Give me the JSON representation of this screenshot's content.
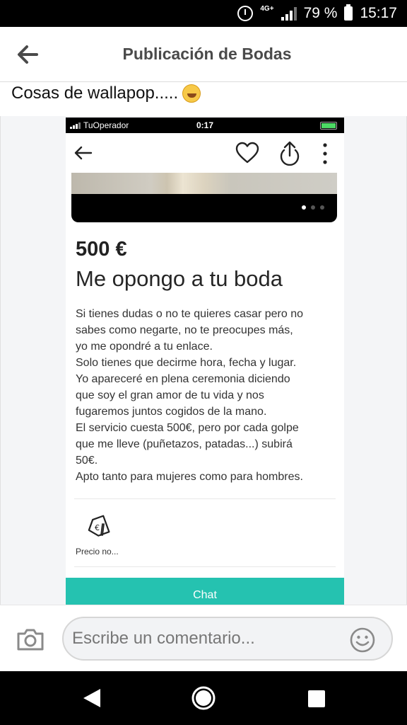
{
  "status_bar": {
    "network": "4G+",
    "battery": "79 %",
    "time": "15:17"
  },
  "app_bar": {
    "title": "Publicación de Bodas"
  },
  "post": {
    "caption": "Cosas de wallapop.....",
    "screenshot": {
      "ios_status": {
        "operator": "TuOperador",
        "time": "0:17"
      },
      "listing": {
        "price": "500 €",
        "title": "Me opongo a tu boda",
        "description_lines": [
          "Si tienes dudas o no te quieres casar pero no",
          "sabes como negarte, no te preocupes más,",
          "yo me opondré a tu enlace.",
          "Solo tienes que decirme hora, fecha y lugar.",
          "Yo apareceré en plena ceremonia diciendo",
          "que soy el gran amor de tu vida y nos",
          "fugaremos juntos cogidos de la mano.",
          "El servicio cuesta 500€, pero por cada golpe",
          "que me lleve (puñetazos, patadas...) subirá",
          "50€.",
          "Apto tanto para mujeres como para hombres."
        ],
        "price_tag_label": "Precio no...",
        "chat_button": "Chat"
      }
    }
  },
  "composer": {
    "placeholder": "Escribe un comentario..."
  },
  "colors": {
    "chat_accent": "#25c2b0",
    "status_bar": "#000000"
  }
}
